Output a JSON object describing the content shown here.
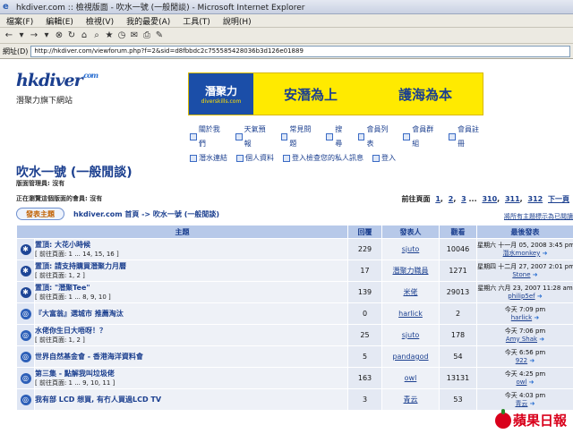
{
  "window": {
    "title": "hkdiver.com :: 檢視版面 - 吹水一號 (一般閒談) - Microsoft Internet Explorer"
  },
  "menu": [
    "檔案(F)",
    "編輯(E)",
    "檢視(V)",
    "我的最愛(A)",
    "工具(T)",
    "說明(H)"
  ],
  "address": {
    "label": "網址(D)",
    "url": "http://hkdiver.com/viewforum.php?f=2&sid=d8fbbdc2c755585428036b3d126e01889"
  },
  "logo": {
    "name": "hkdiver",
    "suffix": ".com",
    "tagline": "潛聚力旗下網站"
  },
  "banner": {
    "brand": "潛聚力",
    "brand_url": "diverskills.com",
    "slogan1": "安潛為上",
    "slogan2": "護海為本"
  },
  "nav": {
    "row1": [
      "關於我們",
      "天氣預報",
      "常見問題",
      "搜尋",
      "會員列表",
      "會員群組",
      "會員註冊"
    ],
    "row2": [
      "潛水連結",
      "個人資料",
      "登入檢查您的私人訊息",
      "登入"
    ]
  },
  "forum": {
    "title": "吹水一號 (一般閒談)",
    "moderators": "版面管理員: 沒有",
    "browsing": "正在瀏覽這個版面的會員: 沒有",
    "goto_label": "前往頁面",
    "pages": [
      "1",
      "2",
      "3",
      "...",
      "310",
      "311",
      "312",
      "下一頁"
    ],
    "new_topic": "發表主題",
    "breadcrumb": "hkdiver.com 首頁 -> 吹水一號 (一般閒談)",
    "mark_read": "將所有主題標示為已閱讀"
  },
  "table": {
    "headers": [
      "主題",
      "回覆",
      "發表人",
      "觀看",
      "最後發表"
    ],
    "rows": [
      {
        "title": "置頂: 大花小時候",
        "pages": "[ 前往頁面: 1 ... 14, 15, 16 ]",
        "replies": "229",
        "author": "sjuto",
        "views": "10046",
        "last_date": "星期六 十一月 05, 2008 3:45 pm",
        "last_user": "潛水monkey"
      },
      {
        "title": "置頂: 請支持購買潛聚力月曆",
        "pages": "[ 前往頁面: 1, 2 ]",
        "replies": "17",
        "author": "潛聚力職員",
        "views": "1271",
        "last_date": "星期四 十二月 27, 2007 2:01 pm",
        "last_user": "Stone"
      },
      {
        "title": "置頂: \"潛聚Tee\"",
        "pages": "[ 前往頁面: 1 ... 8, 9, 10 ]",
        "replies": "139",
        "author": "米佬",
        "views": "29013",
        "last_date": "星期六 六月 23, 2007 11:28 am",
        "last_user": "philip5ef"
      },
      {
        "title": "『大富翁』選城市 推薦淘汰",
        "pages": "",
        "replies": "0",
        "author": "harlick",
        "views": "2",
        "last_date": "今天 7:09 pm",
        "last_user": "harlick"
      },
      {
        "title": "水佬你生日大唔呀！？",
        "pages": "[ 前往頁面: 1, 2 ]",
        "replies": "25",
        "author": "sjuto",
        "views": "178",
        "last_date": "今天 7:06 pm",
        "last_user": "Amy Shak"
      },
      {
        "title": "世界自然基金會 - 香港海洋資料會",
        "pages": "",
        "replies": "5",
        "author": "pandagod",
        "views": "54",
        "last_date": "今天 6:56 pm",
        "last_user": "922"
      },
      {
        "title": "第三集 - 點解我叫垃圾佬",
        "pages": "[ 前往頁面: 1 ... 9, 10, 11 ]",
        "replies": "163",
        "author": "owl",
        "views": "13131",
        "last_date": "今天 4:25 pm",
        "last_user": "owl"
      },
      {
        "title": "我有部 LCD 想買, 有冇人買過LCD TV",
        "pages": "",
        "replies": "3",
        "author": "青云",
        "views": "53",
        "last_date": "今天 4:03 pm",
        "last_user": "青云"
      }
    ]
  },
  "watermark": "蘋果日報"
}
